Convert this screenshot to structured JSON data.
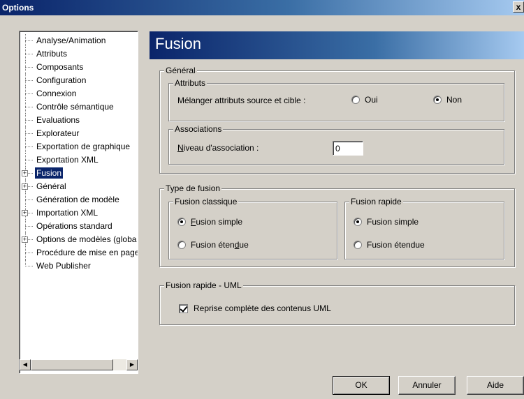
{
  "window": {
    "title": "Options",
    "close_glyph": "x"
  },
  "tree": {
    "items": [
      {
        "label": "Analyse/Animation",
        "expandable": false
      },
      {
        "label": "Attributs",
        "expandable": false
      },
      {
        "label": "Composants",
        "expandable": false
      },
      {
        "label": "Configuration",
        "expandable": false
      },
      {
        "label": "Connexion",
        "expandable": false
      },
      {
        "label": "Contrôle sémantique",
        "expandable": false
      },
      {
        "label": "Evaluations",
        "expandable": false
      },
      {
        "label": "Explorateur",
        "expandable": false
      },
      {
        "label": "Exportation de graphique",
        "expandable": false
      },
      {
        "label": "Exportation XML",
        "expandable": false
      },
      {
        "label": "Fusion",
        "expandable": true,
        "selected": true
      },
      {
        "label": "Général",
        "expandable": true
      },
      {
        "label": "Génération de modèle",
        "expandable": false
      },
      {
        "label": "Importation XML",
        "expandable": true
      },
      {
        "label": "Opérations standard",
        "expandable": false
      },
      {
        "label": "Options de modèles (globa",
        "expandable": true
      },
      {
        "label": "Procédure de mise en page",
        "expandable": false
      },
      {
        "label": "Web Publisher",
        "expandable": false
      }
    ]
  },
  "panel": {
    "title": "Fusion",
    "general": {
      "legend": "Général",
      "attributes": {
        "legend": "Attributs",
        "merge_label": "Mélanger attributs source et cible :",
        "oui_label": "Oui",
        "non_label": "Non",
        "selected": "Non"
      },
      "associations": {
        "legend": "Associations",
        "level_label_prefix": "N",
        "level_label_rest": "iveau d'association :",
        "level_value": "0"
      }
    },
    "fusion_type": {
      "legend": "Type de fusion",
      "classic": {
        "legend": "Fusion classique",
        "simple_prefix": "",
        "simple_mnemonic": "F",
        "simple_rest": "usion simple",
        "extended_prefix": "Fusion éten",
        "extended_mnemonic": "d",
        "extended_rest": "ue",
        "selected": "simple"
      },
      "quick": {
        "legend": "Fusion rapide",
        "simple_label": "Fusion simple",
        "extended_label": "Fusion étendue",
        "selected": "simple"
      }
    },
    "quick_uml": {
      "legend": "Fusion rapide - UML",
      "checkbox_label": "Reprise complète des contenus UML",
      "checked": true
    }
  },
  "buttons": {
    "ok": "OK",
    "cancel": "Annuler",
    "help": "Aide"
  },
  "colors": {
    "title_bar": "#0a246a",
    "header_gradient_end": "#a6caf0",
    "face": "#d4d0c8",
    "selection": "#0a246a"
  }
}
